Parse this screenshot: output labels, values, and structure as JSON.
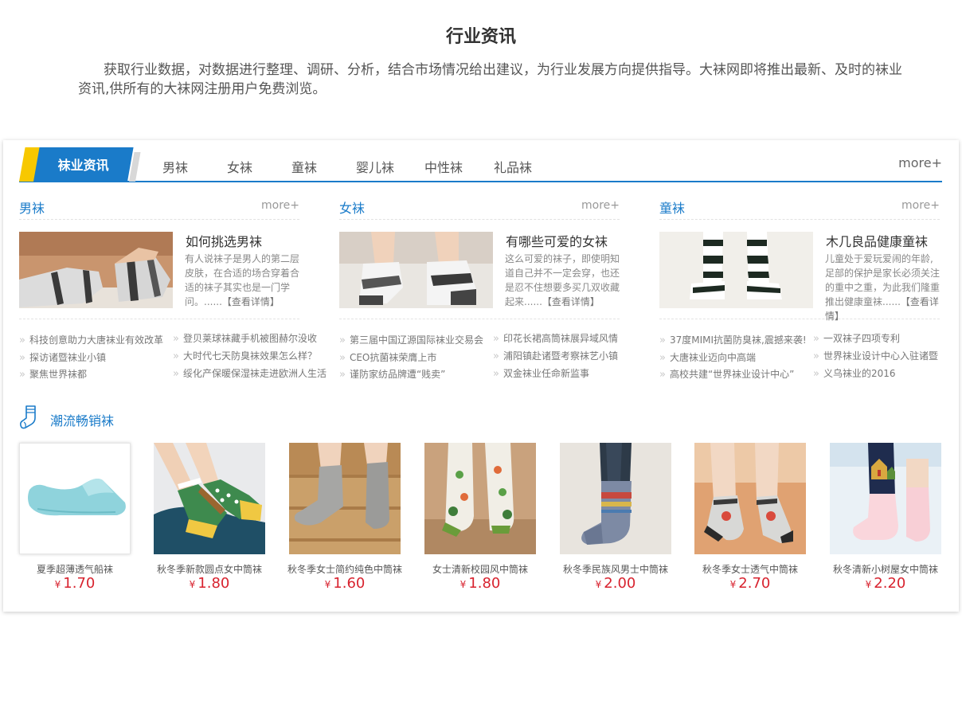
{
  "header": {
    "title": "行业资讯",
    "intro": "获取行业数据，对数据进行整理、调研、分析，结合市场情况给出建议，为行业发展方向提供指导。大袜网即将推出最新、及时的袜业资讯,供所有的大袜网注册用户免费浏览。"
  },
  "tabs": {
    "active": "袜业资讯",
    "items": [
      "男袜",
      "女袜",
      "童袜",
      "婴儿袜",
      "中性袜",
      "礼品袜"
    ],
    "more": "more+"
  },
  "columns": [
    {
      "title": "男袜",
      "more": "more+",
      "feature_title": "如何挑选男袜",
      "feature_desc": "有人说袜子是男人的第二层皮肤，在合适的场合穿着合适的袜子其实也是一门学问。......",
      "feature_link": "【查看详情】",
      "links_left": [
        "科技创意助力大唐袜业有效改革",
        "探访诸暨袜业小镇",
        "聚焦世界袜都"
      ],
      "links_right": [
        "登贝莱球袜藏手机被图赫尔没收",
        "大时代七天防臭袜效果怎么样？",
        "绥化产保暖保湿袜走进欧洲人生活"
      ]
    },
    {
      "title": "女袜",
      "more": "more+",
      "feature_title": "有哪些可爱的女袜",
      "feature_desc": "这么可爱的袜子，即使明知道自己并不一定会穿，也还是忍不住想要多买几双收藏起来......",
      "feature_link": "【查看详情】",
      "links_left": [
        "第三届中国辽源国际袜业交易会",
        "CEO抗菌袜荣膺上市",
        "谨防家纺品牌遭“贱卖”"
      ],
      "links_right": [
        "印花长裙高筒袜展异域风情",
        "浦阳镇赴诸暨考察袜艺小镇",
        "双金袜业任命新监事"
      ]
    },
    {
      "title": "童袜",
      "more": "more+",
      "feature_title": "木几良品健康童袜",
      "feature_desc": "儿童处于爱玩爱闹的年龄,足部的保护是家长必须关注的重中之重，为此我们隆重推出健康童袜......",
      "feature_link": "【查看详情】",
      "links_left": [
        "37度MIMI抗菌防臭袜,震撼来袭!",
        "大唐袜业迈向中高端",
        "高校共建“世界袜业设计中心”"
      ],
      "links_right": [
        "一双袜子四项专利",
        "世界袜业设计中心入驻诸暨",
        "义乌袜业的2016"
      ]
    }
  ],
  "hot": {
    "title": "潮流畅销袜",
    "currency": "¥",
    "products": [
      {
        "name": "夏季超薄透气船袜",
        "price": "1.70"
      },
      {
        "name": "秋冬季新款圆点女中筒袜",
        "price": "1.80"
      },
      {
        "name": "秋冬季女士简约纯色中筒袜",
        "price": "1.60"
      },
      {
        "name": "女士清新校园风中筒袜",
        "price": "1.80"
      },
      {
        "name": "秋冬季民族风男士中筒袜",
        "price": "2.00"
      },
      {
        "name": "秋冬季女士透气中筒袜",
        "price": "2.70"
      },
      {
        "name": "秋冬清新小树屋女中筒袜",
        "price": "2.20"
      }
    ]
  },
  "colors": {
    "accent": "#1a7bc9",
    "highlight": "#f7c800",
    "price": "#d8232f"
  }
}
